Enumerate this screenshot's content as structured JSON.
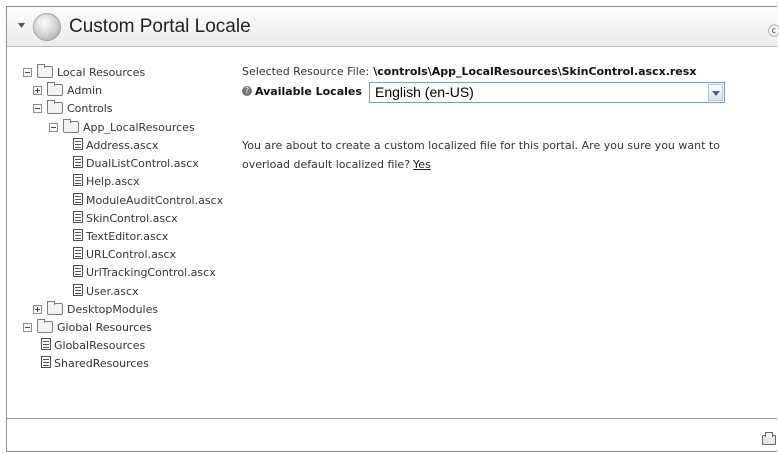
{
  "header": {
    "title": "Custom Portal Locale",
    "collapse_icon": "chevron-down-icon",
    "module_icon": "gear-icon",
    "edge_icon": "info-icon"
  },
  "tree": {
    "nodes": [
      {
        "label": "Local Resources",
        "toggle": "minus",
        "icon": "folder-icon"
      },
      {
        "label": "Admin",
        "toggle": "plus",
        "icon": "folder-icon"
      },
      {
        "label": "Controls",
        "toggle": "minus",
        "icon": "folder-icon"
      },
      {
        "label": "App_LocalResources",
        "toggle": "minus",
        "icon": "folder-icon"
      },
      {
        "label": "Address.ascx",
        "icon": "file-icon"
      },
      {
        "label": "DualListControl.ascx",
        "icon": "file-icon"
      },
      {
        "label": "Help.ascx",
        "icon": "file-icon"
      },
      {
        "label": "ModuleAuditControl.ascx",
        "icon": "file-icon"
      },
      {
        "label": "SkinControl.ascx",
        "icon": "file-icon"
      },
      {
        "label": "TextEditor.ascx",
        "icon": "file-icon"
      },
      {
        "label": "URLControl.ascx",
        "icon": "file-icon"
      },
      {
        "label": "UrlTrackingControl.ascx",
        "icon": "file-icon"
      },
      {
        "label": "User.ascx",
        "icon": "file-icon"
      },
      {
        "label": "DesktopModules",
        "toggle": "plus",
        "icon": "folder-icon"
      },
      {
        "label": "Global Resources",
        "toggle": "minus",
        "icon": "folder-icon"
      },
      {
        "label": "GlobalResources",
        "icon": "file-icon"
      },
      {
        "label": "SharedResources",
        "icon": "file-icon"
      }
    ]
  },
  "main": {
    "resource_label": "Selected Resource File:",
    "resource_path": "\\controls\\App_LocalResources\\SkinControl.ascx.resx",
    "locales_label": "Available Locales",
    "locales_selected": "English (en-US)",
    "message": "You are about to create a custom localized file for this portal. Are you sure you want to overload default localized file?",
    "yes_link": "Yes"
  },
  "footer": {
    "print_icon": "printer-icon"
  }
}
